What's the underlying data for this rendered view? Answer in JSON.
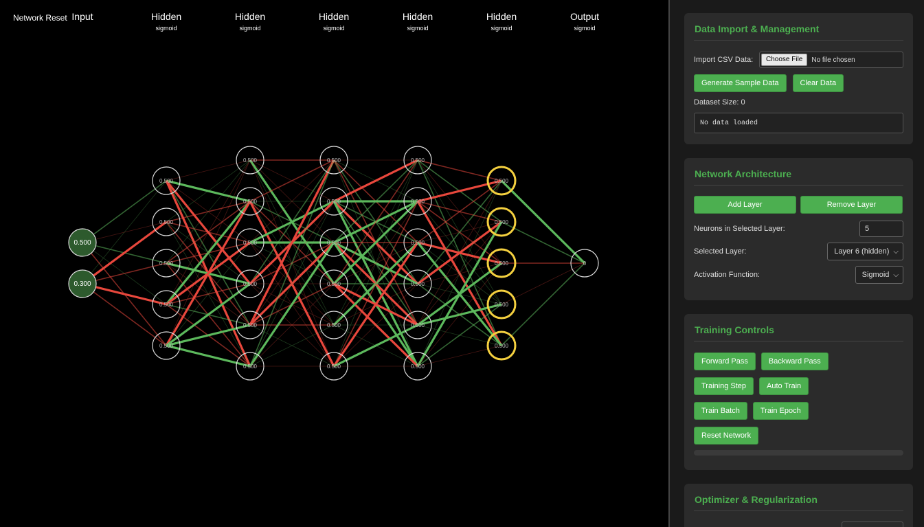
{
  "canvas": {
    "status": "Network Reset",
    "layers": [
      {
        "title": "Input",
        "activation": "",
        "neurons": 2,
        "values": [
          "0.500",
          "0.300"
        ],
        "highlight": false
      },
      {
        "title": "Hidden",
        "activation": "sigmoid",
        "neurons": 5,
        "values": [
          "0.500",
          "0.500",
          "0.500",
          "0.500",
          "0.500"
        ],
        "highlight": false
      },
      {
        "title": "Hidden",
        "activation": "sigmoid",
        "neurons": 6,
        "values": [
          "0.500",
          "0.500",
          "0.500",
          "0.500",
          "0.500",
          "0.500"
        ],
        "highlight": false
      },
      {
        "title": "Hidden",
        "activation": "sigmoid",
        "neurons": 6,
        "values": [
          "0.500",
          "0.500",
          "0.500",
          "0.500",
          "0.500",
          "0.500"
        ],
        "highlight": false
      },
      {
        "title": "Hidden",
        "activation": "sigmoid",
        "neurons": 6,
        "values": [
          "0.500",
          "0.500",
          "0.500",
          "0.500",
          "0.500",
          "0.500"
        ],
        "highlight": false
      },
      {
        "title": "Hidden",
        "activation": "sigmoid",
        "neurons": 5,
        "values": [
          "0.500",
          "0.500",
          "0.500",
          "0.500",
          "0.500"
        ],
        "highlight": true
      },
      {
        "title": "Output",
        "activation": "sigmoid",
        "neurons": 1,
        "values": [
          "0"
        ],
        "highlight": false
      }
    ],
    "colors": {
      "positive": "#5cb85c",
      "negative": "#e8473c",
      "neuron_border": "#dddddd",
      "highlight_border": "#f4d03f",
      "input_fill": "#2d5a2d"
    }
  },
  "data_import": {
    "title": "Data Import & Management",
    "import_label": "Import CSV Data:",
    "choose_file": "Choose File",
    "no_file": "No file chosen",
    "generate_button": "Generate Sample Data",
    "clear_button": "Clear Data",
    "dataset_size": "Dataset Size: 0",
    "data_preview": "No data loaded"
  },
  "architecture": {
    "title": "Network Architecture",
    "add_layer": "Add Layer",
    "remove_layer": "Remove Layer",
    "neurons_label": "Neurons in Selected Layer:",
    "neurons_value": "5",
    "selected_layer_label": "Selected Layer:",
    "selected_layer_value": "Layer 6 (hidden)",
    "activation_label": "Activation Function:",
    "activation_value": "Sigmoid"
  },
  "training": {
    "title": "Training Controls",
    "forward": "Forward Pass",
    "backward": "Backward Pass",
    "step": "Training Step",
    "auto": "Auto Train",
    "batch": "Train Batch",
    "epoch": "Train Epoch",
    "reset": "Reset Network"
  },
  "optimizer": {
    "title": "Optimizer & Regularization"
  }
}
